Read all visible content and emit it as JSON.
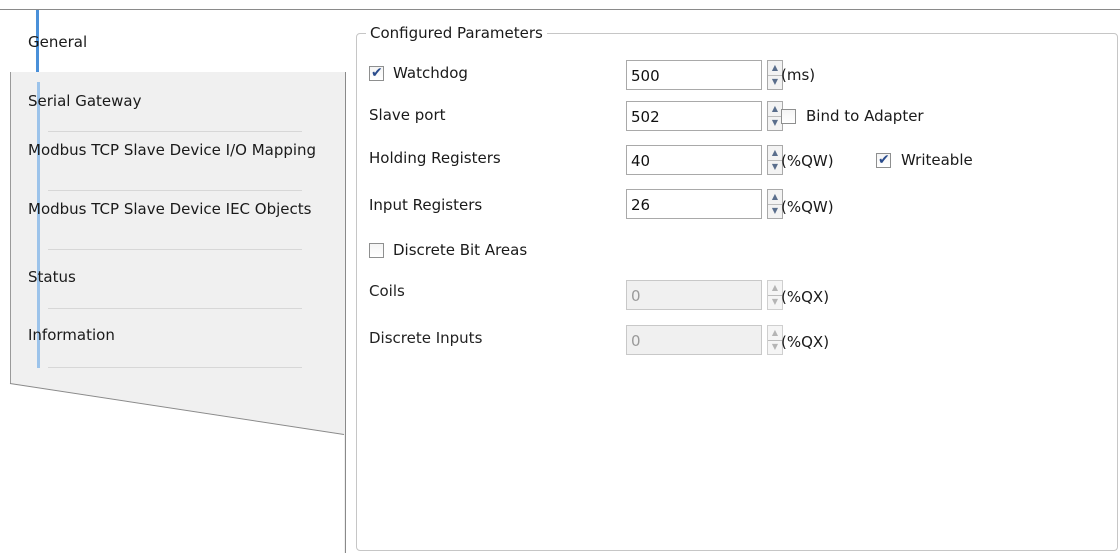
{
  "tabs": [
    {
      "label": "General",
      "active": true
    },
    {
      "label": "Serial Gateway"
    },
    {
      "label": "Modbus TCP Slave Device I/O Mapping"
    },
    {
      "label": "Modbus TCP Slave Device IEC Objects"
    },
    {
      "label": "Status"
    },
    {
      "label": "Information"
    }
  ],
  "group": {
    "title": "Configured Parameters"
  },
  "watchdog": {
    "label": "Watchdog",
    "checked": true,
    "value": "500",
    "unit": "(ms)"
  },
  "slave_port": {
    "label": "Slave port",
    "value": "502",
    "bind_label": "Bind to Adapter",
    "bind_checked": false
  },
  "holding_registers": {
    "label": "Holding Registers",
    "value": "40",
    "unit": "(%QW)",
    "writeable_label": "Writeable",
    "writeable_checked": true
  },
  "input_registers": {
    "label": "Input Registers",
    "value": "26",
    "unit": "(%QW)"
  },
  "discrete_bit_areas": {
    "label": "Discrete Bit Areas",
    "checked": false
  },
  "coils": {
    "label": "Coils",
    "value": "0",
    "unit": "(%QX)",
    "disabled": true
  },
  "discrete_inputs": {
    "label": "Discrete Inputs",
    "value": "0",
    "unit": "(%QX)",
    "disabled": true
  },
  "colors": {
    "accent": "#4a90d9",
    "tab_bg": "#f0f0f0"
  },
  "icons": {
    "checkbox_checked": "checkmark-icon",
    "spin_up": "up-arrow-icon",
    "spin_down": "down-arrow-icon"
  }
}
